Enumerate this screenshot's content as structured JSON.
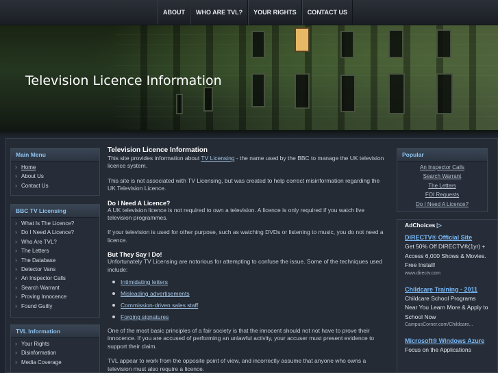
{
  "nav": {
    "items": [
      "ABOUT",
      "WHO ARE TVL?",
      "YOUR RIGHTS",
      "CONTACT US"
    ]
  },
  "banner": {
    "title": "Television Licence Information"
  },
  "main_menu": {
    "title": "Main Menu",
    "items": [
      "Home",
      "About Us",
      "Contact Us"
    ]
  },
  "bbc_tv_licensing": {
    "title": "BBC TV Licensing",
    "items": [
      "What Is The Licence?",
      "Do I Need A Licence?",
      "Who Are TVL?",
      "The Letters",
      "The Database",
      "Detector Vans",
      "An Inspector Calls",
      "Search Warrant",
      "Proving Innocence",
      "Found Guilty"
    ]
  },
  "tvl_information": {
    "title": "TVL Information",
    "items": [
      "Your Rights",
      "Disinformation",
      "Media Coverage"
    ]
  },
  "content": {
    "title": "Television Licence Information",
    "p1_before": "This site provides information about ",
    "p1_link": "TV Licensing",
    "p1_after": " - the name used by the BBC to manage the UK television licence system.",
    "p2": "This site is not associated with TV Licensing, but was created to help correct misinformation regarding the UK Television Licence.",
    "h_need": "Do I Need A Licence?",
    "p3": "A UK television licence is not required to own a television. A licence is only required if you watch live television programmes.",
    "p4": "If your television is used for other purpose, such as watching DVDs or listening to music, you do not need a licence.",
    "h_say": "But They Say I Do!",
    "p5": "Unfortunately TV Licensing are notorious for attempting to confuse the issue. Some of the techniques used include:",
    "techniques": [
      "Intimidating letters",
      "Misleading advertisements",
      "Commission-driven sales staff",
      "Forging signatures"
    ],
    "p6": "One of the most basic principles of a fair society is that the innocent should not not have to prove their innocence. If you are accused of performing an unlawful activity, your accuser must present evidence to support their claim.",
    "p7": "TVL appear to work from the opposite point of view, and incorrectly assume that anyone who owns a television must also require a licence."
  },
  "popular": {
    "title": "Popular",
    "items": [
      "An Inspector Calls",
      "Search Warrant",
      "The Letters",
      "FOI Requests",
      "Do I Need A Licence?"
    ]
  },
  "ads": {
    "label": "AdChoices",
    "items": [
      {
        "title": "DIRECTV® Official Site",
        "body": "Get 50% Off DIRECTV®(1yr) + Access 6,000 Shows & Movies. Free Install!",
        "url": "www.directv.com"
      },
      {
        "title": "Childcare Training - 2011",
        "body": "Childcare School Programs Near You Learn More & Apply to School Now",
        "url": "CampusCorner.com/Childcare..."
      },
      {
        "title": "Microsoft® Windows Azure",
        "body": "Focus on the Applications",
        "url": ""
      }
    ]
  }
}
